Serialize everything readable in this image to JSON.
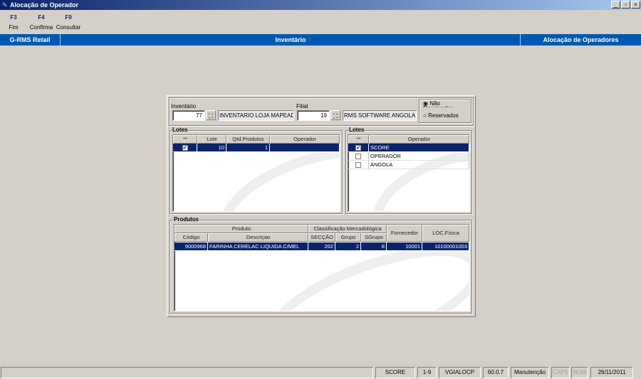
{
  "window": {
    "title": "Alocação de Operador",
    "buttons": [
      "_",
      "▫",
      "×"
    ]
  },
  "toolbar": [
    {
      "key": "F3",
      "label": "Fim"
    },
    {
      "key": "F4",
      "label": "Confirma"
    },
    {
      "key": "F9",
      "label": "Consultar"
    }
  ],
  "header": {
    "app": "G-RMS Retail",
    "module": "Inventário",
    "screen": "Alocação de Operadores"
  },
  "filters": {
    "inventario_label": "Inventário",
    "inventario_value": "77",
    "inventario_desc": "INVENTARIO LOJA MAPEADA",
    "filial_label": "Filial",
    "filial_value": "19",
    "filial_desc": "RMS SOFTWARE ANGOLA",
    "radio_options": [
      "Não Reservados",
      "Reservados"
    ],
    "radio_selected": "Não Reservados"
  },
  "lotes": {
    "title": "Lotes",
    "columns": [
      "**",
      "Lote",
      "Qtd.Produtos",
      "Operador"
    ],
    "rows": [
      {
        "checked": true,
        "lote": "10",
        "qtd": "1",
        "operador": ""
      }
    ]
  },
  "operadores": {
    "title": "Lotes",
    "columns": [
      "**",
      "Operador"
    ],
    "rows": [
      {
        "checked": true,
        "name": "SCORE"
      },
      {
        "checked": false,
        "name": "OPERADOR"
      },
      {
        "checked": false,
        "name": "ANGOLA"
      }
    ]
  },
  "produtos": {
    "title": "Produtos",
    "group_headers": [
      "Produto",
      "Classificação Mercadológica",
      "Fornecedor",
      "LOC.Física"
    ],
    "columns": [
      "Código",
      "Descriçao",
      "SECÇÃO",
      "Grupo",
      "SGrupo"
    ],
    "rows": [
      {
        "codigo": "9000968",
        "descricao": "FARINHA CERELAC LIQUIDA C/MEL",
        "seccao": "202",
        "grupo": "2",
        "sgrupo": "8",
        "fornecedor": "10001",
        "loc": "10100001003"
      }
    ]
  },
  "status": [
    "SCORE",
    "1-9",
    "VGIALOCP",
    "60.0.7",
    "Manutenção",
    "CAPS",
    "NUM",
    "26/11/2011"
  ]
}
